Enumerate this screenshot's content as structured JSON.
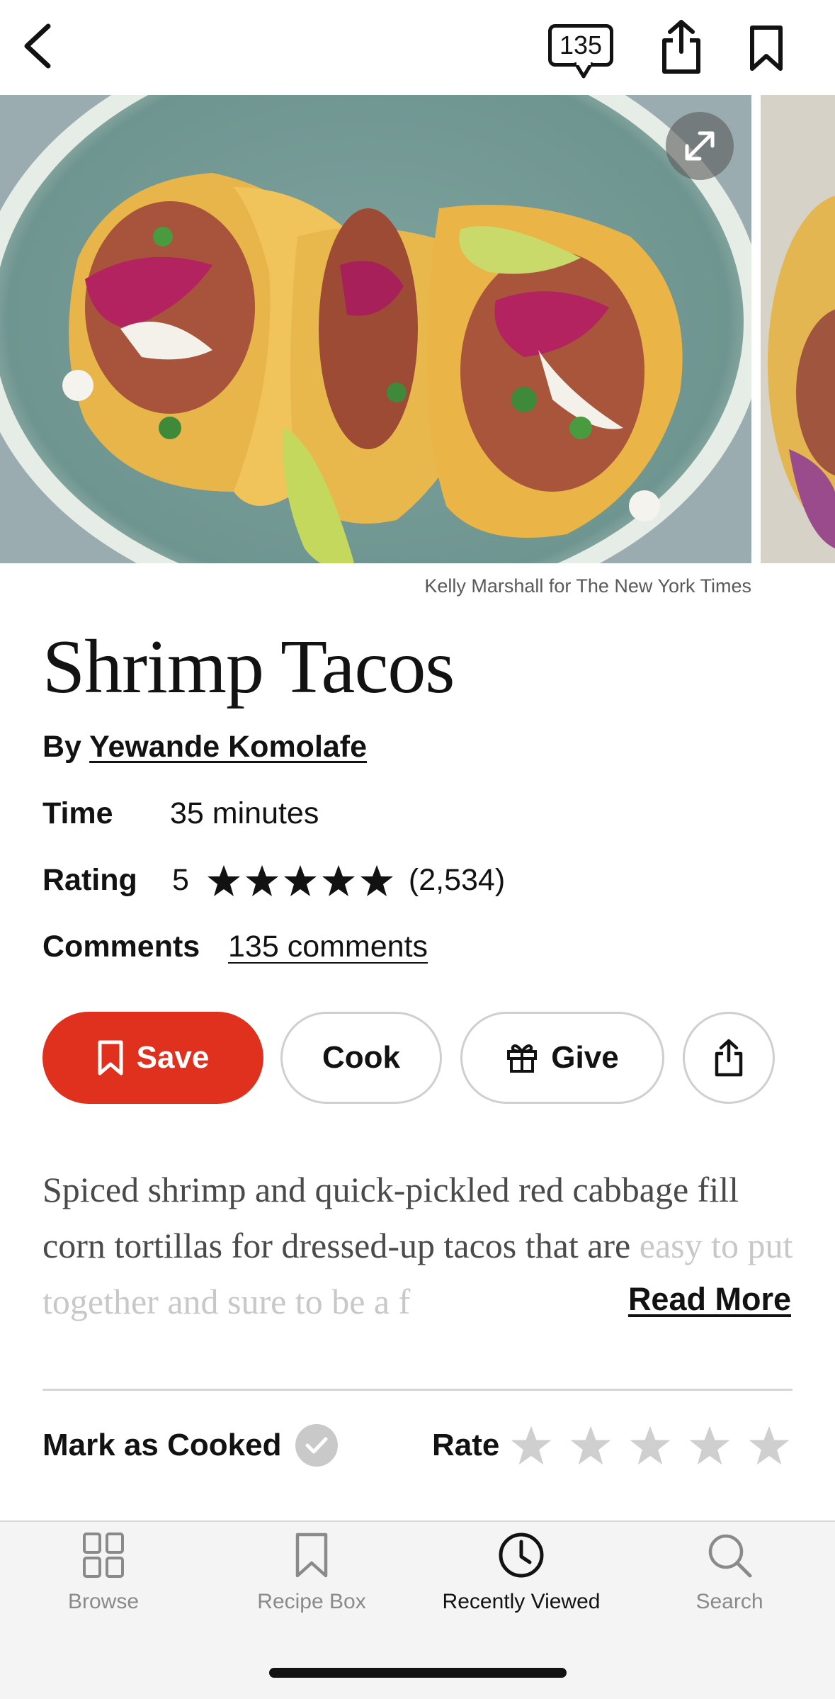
{
  "topbar": {
    "comments_count": "135"
  },
  "hero": {
    "photo_credit": "Kelly Marshall for The New York Times"
  },
  "recipe": {
    "title": "Shrimp Tacos",
    "by_prefix": "By ",
    "author": "Yewande Komolafe",
    "time_label": "Time",
    "time_value": "35 minutes",
    "rating_label": "Rating",
    "rating_value": "5",
    "rating_stars": 5,
    "rating_count": "(2,534)",
    "comments_label": "Comments",
    "comments_link": "135 comments",
    "description_visible": "Spiced shrimp and quick-pickled red cabbage fill corn tortillas for dressed-up tacos that are",
    "description_faded": "easy to put together and sure to be a f",
    "read_more": "Read More"
  },
  "actions": {
    "save": "Save",
    "cook": "Cook",
    "give": "Give"
  },
  "feedback": {
    "mark_cooked": "Mark as Cooked",
    "rate": "Rate"
  },
  "tabs": [
    {
      "label": "Browse",
      "icon": "grid-icon",
      "active": false
    },
    {
      "label": "Recipe Box",
      "icon": "bookmark-icon",
      "active": false
    },
    {
      "label": "Recently Viewed",
      "icon": "clock-icon",
      "active": true
    },
    {
      "label": "Search",
      "icon": "search-icon",
      "active": false
    }
  ],
  "colors": {
    "accent_red": "#e0301e",
    "text": "#121212",
    "muted": "#8a8a8a"
  }
}
